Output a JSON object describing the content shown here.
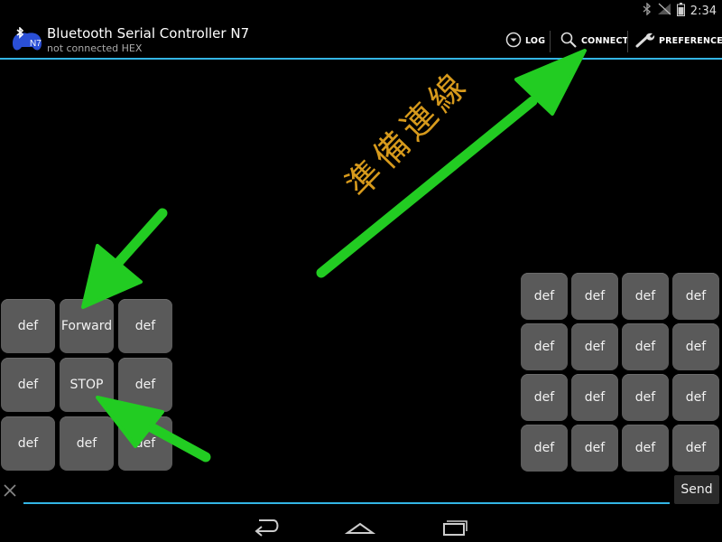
{
  "status_bar": {
    "time": "2:34",
    "icons": [
      "bluetooth-icon",
      "no-signal-icon",
      "battery-icon"
    ]
  },
  "action_bar": {
    "title": "Bluetooth Serial Controller N7",
    "subtitle": "not connected  HEX",
    "actions": {
      "log": "LOG",
      "connect": "CONNECT",
      "preference": "PREFERENCE"
    }
  },
  "left_pad": [
    [
      "def",
      "Forward",
      "def"
    ],
    [
      "def",
      "STOP",
      "def"
    ],
    [
      "def",
      "def",
      "def"
    ]
  ],
  "right_pad": [
    [
      "def",
      "def",
      "def",
      "def"
    ],
    [
      "def",
      "def",
      "def",
      "def"
    ],
    [
      "def",
      "def",
      "def",
      "def"
    ],
    [
      "def",
      "def",
      "def",
      "def"
    ]
  ],
  "input": {
    "value": "",
    "placeholder": "",
    "send_label": "Send"
  },
  "annotation": {
    "text": "準備連線",
    "color": "#d79a1c",
    "arrow_color": "#22cc22"
  },
  "colors": {
    "accent": "#33b5e5",
    "pad_button": "#5a5a5a"
  }
}
